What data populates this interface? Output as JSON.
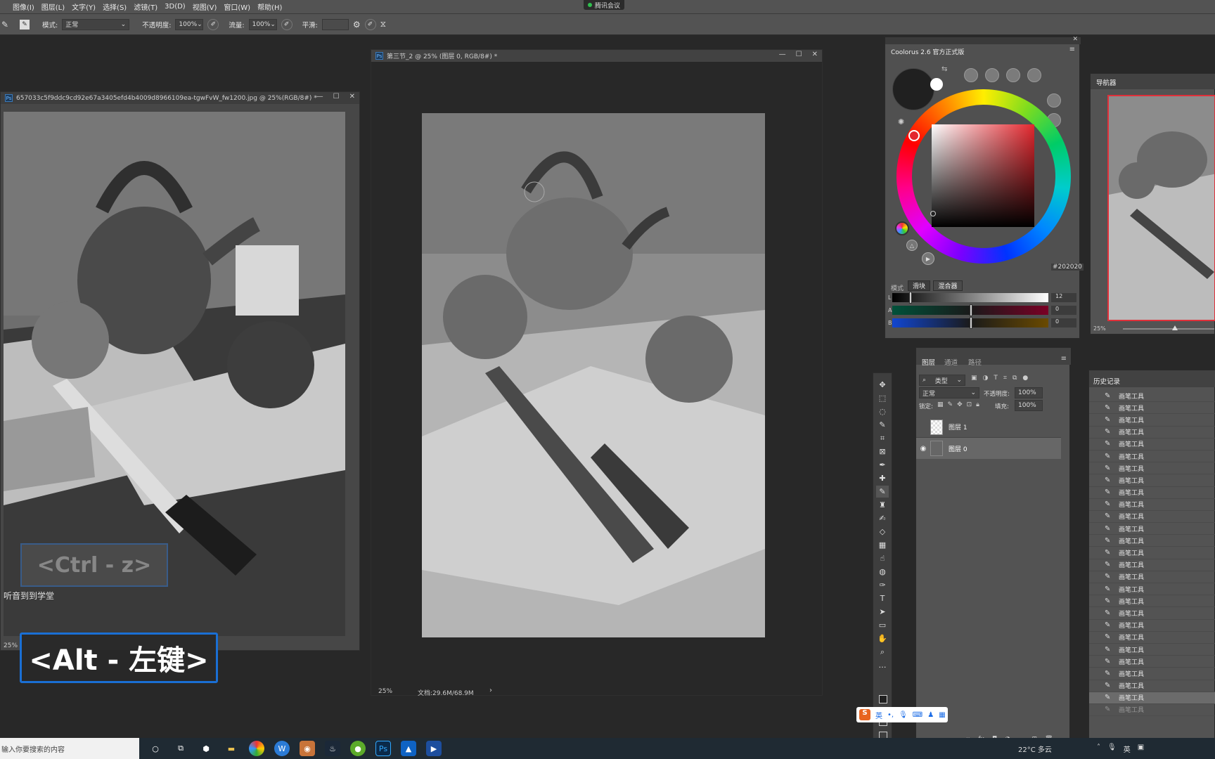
{
  "menubar": {
    "items": [
      "图像(I)",
      "图层(L)",
      "文字(Y)",
      "选择(S)",
      "滤镜(T)",
      "3D(D)",
      "视图(V)",
      "窗口(W)",
      "帮助(H)"
    ],
    "meeting": "腾讯会议"
  },
  "options": {
    "mode_label": "模式:",
    "mode_value": "正常",
    "opacity_label": "不透明度:",
    "opacity_value": "100%",
    "flow_label": "流量:",
    "flow_value": "100%",
    "smooth_label": "平滑:"
  },
  "doc_left": {
    "title": "657033c5f9ddc9cd92e67a3405efd4b4009d8966109ea-tgwFvW_fw1200.jpg @ 25%(RGB/8#) *",
    "zoom": "25%",
    "overlay_text": "听音到到学堂"
  },
  "doc_main": {
    "title": "第三节_2 @ 25% (图层 0, RGB/8#) *",
    "zoom": "25%",
    "doc_size": "文档:29.6M/68.9M"
  },
  "coolorus": {
    "title": "Coolorus 2.6 官方正式版",
    "hex": "202020",
    "mode_label": "模式",
    "tab_slider": "滑块",
    "tab_mixer": "混合器",
    "sliders": [
      {
        "label": "L",
        "value": "12"
      },
      {
        "label": "A",
        "value": "0"
      },
      {
        "label": "B",
        "value": "0"
      }
    ]
  },
  "navigator": {
    "title": "导航器",
    "zoom": "25%"
  },
  "layers": {
    "tabs": [
      "图层",
      "通道",
      "路径"
    ],
    "filter": "类型",
    "blend": "正常",
    "opacity_label": "不透明度:",
    "opacity_value": "100%",
    "lock_label": "锁定:",
    "fill_label": "填充:",
    "fill_value": "100%",
    "items": [
      {
        "name": "图层 1"
      },
      {
        "name": "图层 0"
      }
    ]
  },
  "history": {
    "title": "历史记录",
    "item_label": "画笔工具",
    "count": 27
  },
  "key_hint_1": "<Ctrl - z>",
  "key_hint_2": "<Alt - 左键>",
  "ime": {
    "label": "英"
  },
  "taskbar": {
    "search_placeholder": "输入你要搜索的内容",
    "weather": "22°C 多云",
    "lang": "英"
  },
  "colors": {
    "accent": "#1a6fd4",
    "nav_frame": "#e0303a"
  }
}
